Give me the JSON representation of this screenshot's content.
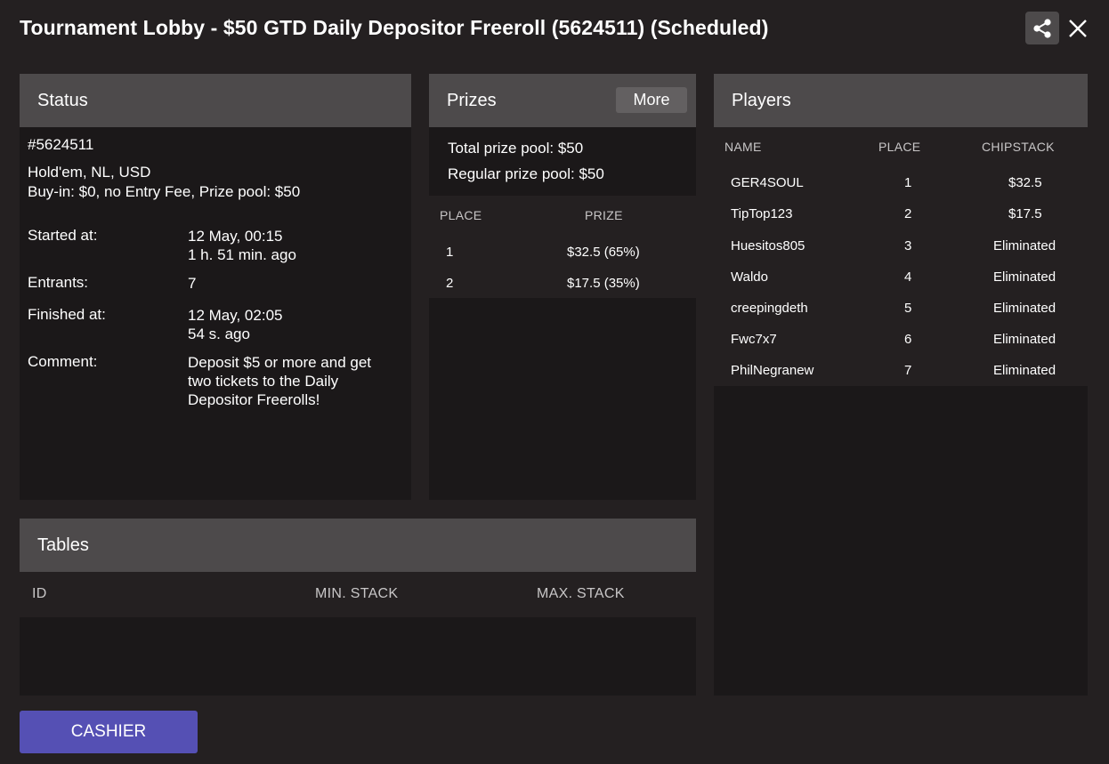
{
  "window": {
    "title": "Tournament Lobby - $50 GTD Daily Depositor Freeroll (5624511) (Scheduled)"
  },
  "icons": {
    "share": "share-icon",
    "close": "close-icon"
  },
  "status": {
    "header": "Status",
    "id": "#5624511",
    "game": "Hold'em, NL, USD",
    "buyin": "Buy-in: $0, no Entry Fee, Prize pool: $50",
    "started_label": "Started at:",
    "started_value": "12 May, 00:15",
    "started_ago": "1 h. 51 min. ago",
    "entrants_label": "Entrants:",
    "entrants_value": "7",
    "finished_label": "Finished at:",
    "finished_value": "12 May, 02:05",
    "finished_ago": "54 s. ago",
    "comment_label": "Comment:",
    "comment_value": "Deposit $5 or more and get two tickets to the Daily Depositor Freerolls!"
  },
  "prizes": {
    "header": "Prizes",
    "more_label": "More",
    "total_label": "Total prize pool:",
    "total_value": "$50",
    "regular_label": "Regular prize pool:",
    "regular_value": "$50",
    "col_place": "PLACE",
    "col_prize": "PRIZE",
    "rows": [
      {
        "place": "1",
        "prize": "$32.5 (65%)"
      },
      {
        "place": "2",
        "prize": "$17.5 (35%)"
      }
    ]
  },
  "players": {
    "header": "Players",
    "col_name": "NAME",
    "col_place": "PLACE",
    "col_chipstack": "CHIPSTACK",
    "rows": [
      {
        "name": "GER4SOUL",
        "place": "1",
        "chipstack": "$32.5"
      },
      {
        "name": "TipTop123",
        "place": "2",
        "chipstack": "$17.5"
      },
      {
        "name": "Huesitos805",
        "place": "3",
        "chipstack": "Eliminated"
      },
      {
        "name": "Waldo",
        "place": "4",
        "chipstack": "Eliminated"
      },
      {
        "name": "creepingdeth",
        "place": "5",
        "chipstack": "Eliminated"
      },
      {
        "name": "Fwc7x7",
        "place": "6",
        "chipstack": "Eliminated"
      },
      {
        "name": "PhilNegranew",
        "place": "7",
        "chipstack": "Eliminated"
      }
    ]
  },
  "tables": {
    "header": "Tables",
    "col_id": "ID",
    "col_min": "MIN. STACK",
    "col_max": "MAX. STACK"
  },
  "footer": {
    "cashier_label": "CASHIER"
  },
  "colors": {
    "background": "#242021",
    "panel": "#1b1819",
    "panel_header": "#4d4a4b",
    "cashier_button": "#5550b4"
  }
}
